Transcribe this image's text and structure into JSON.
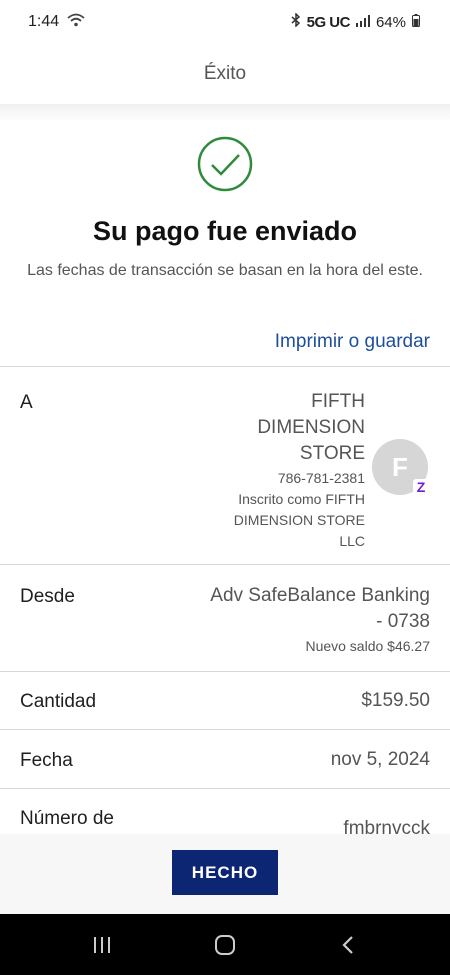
{
  "status": {
    "time": "1:44",
    "network": "5G UC",
    "battery": "64%"
  },
  "header": {
    "title": "Éxito"
  },
  "success": {
    "title": "Su pago fue enviado",
    "subtitle": "Las fechas de transacción se basan en la hora del este."
  },
  "actions": {
    "print_label": "Imprimir o guardar",
    "done_label": "HECHO"
  },
  "recipient": {
    "label": "A",
    "name_lines": [
      "FIFTH",
      "DIMENSION",
      "STORE"
    ],
    "phone": "786-781-2381",
    "enrolled_lines": [
      "Inscrito como FIFTH",
      "DIMENSION STORE",
      "LLC"
    ],
    "avatar_initial": "F",
    "badge": "Z"
  },
  "from": {
    "label": "Desde",
    "account_lines": [
      "Adv SafeBalance Banking",
      "- 0738"
    ],
    "balance": "Nuevo saldo $46.27"
  },
  "amount": {
    "label": "Cantidad",
    "value": "$159.50"
  },
  "date": {
    "label": "Fecha",
    "value": "nov 5, 2024"
  },
  "confirmation": {
    "label": "Número de",
    "value": "fmbrnvcck"
  },
  "colors": {
    "accent": "#1e4f9c",
    "success": "#2e8b3a",
    "button": "#0c2674",
    "zelle": "#6d1ed4"
  }
}
